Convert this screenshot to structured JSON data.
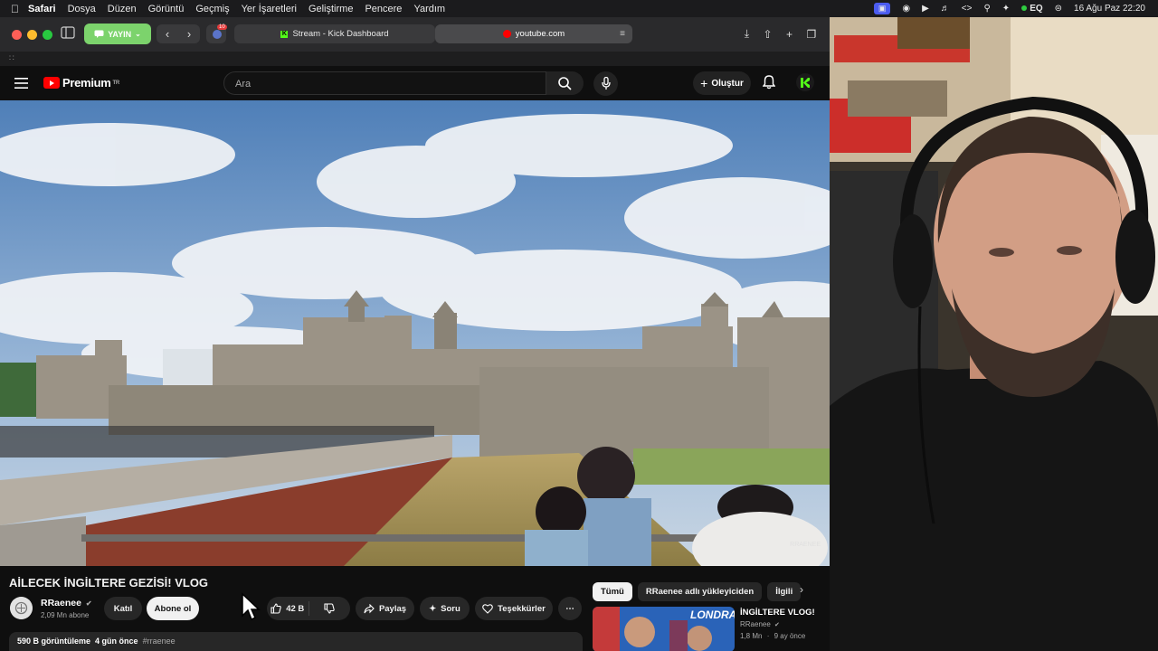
{
  "menubar": {
    "app": "Safari",
    "items": [
      "Dosya",
      "Düzen",
      "Görüntü",
      "Geçmiş",
      "Yer İşaretleri",
      "Geliştirme",
      "Pencere",
      "Yardım"
    ],
    "status_eq": "EQ",
    "datetime": "16 Ağu Paz  22:20"
  },
  "browser": {
    "stream_button": "YAYIN",
    "extension_count": "10",
    "tabs": [
      {
        "label": "Stream - Kick Dashboard"
      },
      {
        "label": "youtube.com"
      }
    ]
  },
  "youtube": {
    "logo_text": "Premium",
    "region": "TR",
    "search_placeholder": "Ara",
    "create_label": "Oluştur"
  },
  "video": {
    "title": "AİLECEK İNGİLTERE GEZİSİ! VLOG",
    "watermark": "RRAENEE",
    "channel_name": "RRaenee",
    "subscribers": "2,09 Mn abone",
    "join_label": "Katıl",
    "subscribe_label": "Abone ol",
    "likes": "42 B",
    "share_label": "Paylaş",
    "ask_label": "Soru",
    "thanks_label": "Teşekkürler",
    "views": "590 B görüntüleme",
    "age": "4 gün önce",
    "hashtag": "#rraenee"
  },
  "sidebar": {
    "chips": [
      {
        "label": "Tümü",
        "active": true
      },
      {
        "label": "RRaenee adlı yükleyiciden",
        "active": false
      },
      {
        "label": "İlgili",
        "active": false
      }
    ],
    "recommendation": {
      "thumb_text": "LONDRA",
      "title": "İNGİLTERE VLOG!",
      "channel": "RRaenee",
      "views": "1,8 Mn",
      "age": "9 ay önce"
    }
  },
  "colors": {
    "yt_red": "#ff0000",
    "kick_green": "#53fc18",
    "stream_green": "#7cd36c",
    "dark_bg": "#0f0f0f"
  }
}
